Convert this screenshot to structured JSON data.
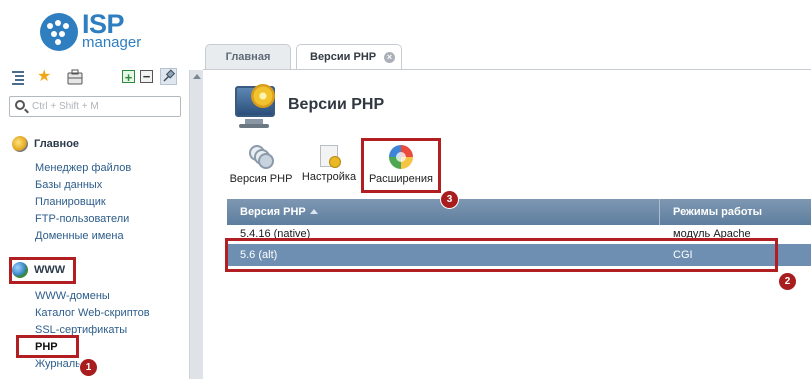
{
  "app": {
    "logo_main": "ISP",
    "logo_sub": "manager"
  },
  "sidebar": {
    "search_placeholder": "Ctrl + Shift + M",
    "groups": [
      {
        "label": "Главное",
        "items": [
          "Менеджер файлов",
          "Базы данных",
          "Планировщик",
          "FTP-пользователи",
          "Доменные имена"
        ]
      },
      {
        "label": "WWW",
        "items": [
          "WWW-домены",
          "Каталог Web-скриптов",
          "SSL-сертификаты",
          "PHP",
          "Журналы"
        ]
      }
    ]
  },
  "tabs": [
    {
      "label": "Главная"
    },
    {
      "label": "Версии PHP"
    }
  ],
  "page": {
    "title": "Версии PHP"
  },
  "actions": [
    {
      "label": "Версия PHP"
    },
    {
      "label": "Настройка"
    },
    {
      "label": "Расширения"
    }
  ],
  "table": {
    "columns": [
      "Версия PHP",
      "Режимы работы"
    ],
    "rows": [
      [
        "5.4.16 (native)",
        "модуль Apache"
      ],
      [
        "5.6 (alt)",
        "CGI"
      ]
    ]
  },
  "annotations": {
    "badges": [
      "1",
      "2",
      "3"
    ]
  },
  "colors": {
    "brand": "#2f7ec0",
    "highlight": "#b11f22",
    "selected_row": "#6f8fb2",
    "header": "#6e89a8"
  }
}
